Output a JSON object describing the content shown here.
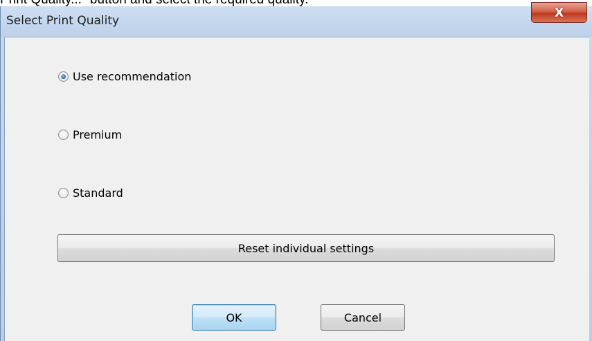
{
  "caption": "Print Quality...\" button and select the required quality.",
  "window": {
    "title": "Select Print Quality",
    "close_glyph": "X"
  },
  "options": [
    {
      "label": "Use recommendation",
      "checked": true
    },
    {
      "label": "Premium",
      "checked": false
    },
    {
      "label": "Standard",
      "checked": false
    }
  ],
  "buttons": {
    "reset": "Reset individual settings",
    "ok": "OK",
    "cancel": "Cancel"
  },
  "icons": {
    "close": "close-icon",
    "radio_selected": "radio-selected-icon",
    "radio_unselected": "radio-unselected-icon"
  },
  "colors": {
    "title_bar": "#c9d9ec",
    "close_button": "#c9452b",
    "client_background": "#f0f0f0",
    "default_button_border": "#3c7fb1"
  }
}
